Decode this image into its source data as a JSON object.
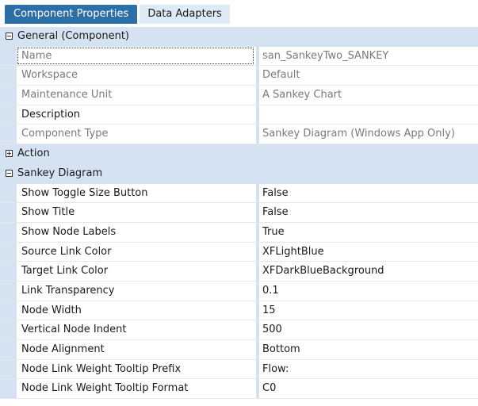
{
  "tabs": [
    {
      "label": "Component Properties",
      "active": true
    },
    {
      "label": "Data Adapters",
      "active": false
    }
  ],
  "categories": {
    "general": {
      "label": "General (Component)",
      "expanded": true
    },
    "action": {
      "label": "Action",
      "expanded": false
    },
    "sankey": {
      "label": "Sankey Diagram",
      "expanded": true
    }
  },
  "general_rows": [
    {
      "name": "Name",
      "value": "san_SankeyTwo_SANKEY",
      "muted": true,
      "selected": true
    },
    {
      "name": "Workspace",
      "value": "Default",
      "muted": true
    },
    {
      "name": "Maintenance Unit",
      "value": "A Sankey Chart",
      "muted": true
    },
    {
      "name": "Description",
      "value": "",
      "muted": false
    },
    {
      "name": "Component Type",
      "value": "Sankey Diagram (Windows App Only)",
      "muted": true
    }
  ],
  "sankey_rows": [
    {
      "name": "Show Toggle Size Button",
      "value": "False"
    },
    {
      "name": "Show Title",
      "value": "False"
    },
    {
      "name": "Show Node Labels",
      "value": "True"
    },
    {
      "name": "Source Link Color",
      "value": "XFLightBlue"
    },
    {
      "name": "Target Link Color",
      "value": "XFDarkBlueBackground"
    },
    {
      "name": "Link Transparency",
      "value": "0.1"
    },
    {
      "name": "Node Width",
      "value": "15"
    },
    {
      "name": "Vertical Node Indent",
      "value": "500"
    },
    {
      "name": "Node Alignment",
      "value": "Bottom"
    },
    {
      "name": "Node Link Weight Tooltip Prefix",
      "value": "Flow:"
    },
    {
      "name": "Node Link Weight Tooltip Format",
      "value": "C0"
    }
  ]
}
